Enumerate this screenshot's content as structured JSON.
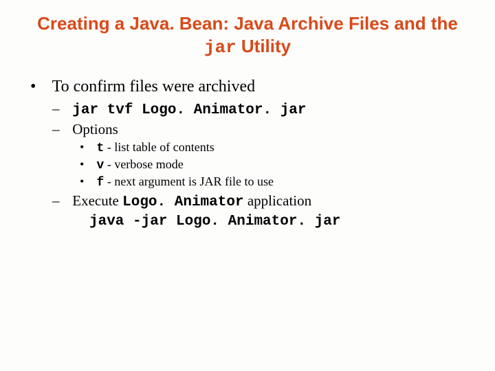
{
  "title": {
    "pre": "Creating a Java. Bean: Java Archive Files and the ",
    "mono": "jar",
    "post": " Utility"
  },
  "bullet1": "To confirm files were archived",
  "sub1": {
    "mono": "jar tvf Logo. Animator. jar"
  },
  "sub2": "Options",
  "opts": {
    "t": {
      "code": "t",
      "sep": "  - ",
      "desc": "list table of contents"
    },
    "v": {
      "code": "v",
      "sep": " - ",
      "desc": "verbose mode"
    },
    "f": {
      "code": "f",
      "sep": " - ",
      "desc": "next argument is JAR file to use"
    }
  },
  "sub3": {
    "pre": "Execute ",
    "mono": "Logo. Animator",
    "post": " application"
  },
  "cmd": {
    "mono": "java -jar Logo. Animator. jar"
  }
}
